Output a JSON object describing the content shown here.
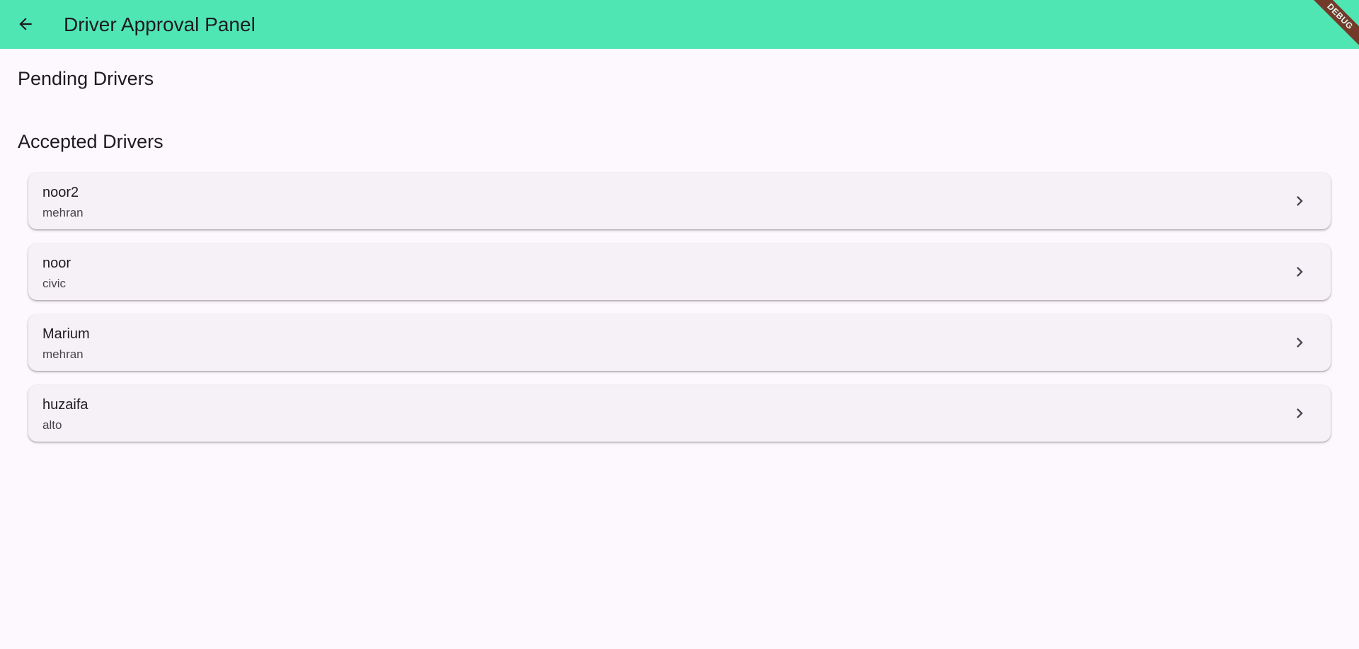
{
  "appbar": {
    "title": "Driver Approval Panel",
    "back_icon": "arrow-back-icon",
    "color": "#4fe6b4",
    "debug_label": "DEBUG"
  },
  "sections": {
    "pending": {
      "heading": "Pending Drivers"
    },
    "accepted": {
      "heading": "Accepted Drivers",
      "drivers": [
        {
          "name": "noor2",
          "car": "mehran"
        },
        {
          "name": "noor",
          "car": "civic"
        },
        {
          "name": "Marium",
          "car": "mehran"
        },
        {
          "name": "huzaifa",
          "car": "alto"
        }
      ]
    }
  },
  "icons": {
    "row_trailing": "chevron-right-icon"
  }
}
